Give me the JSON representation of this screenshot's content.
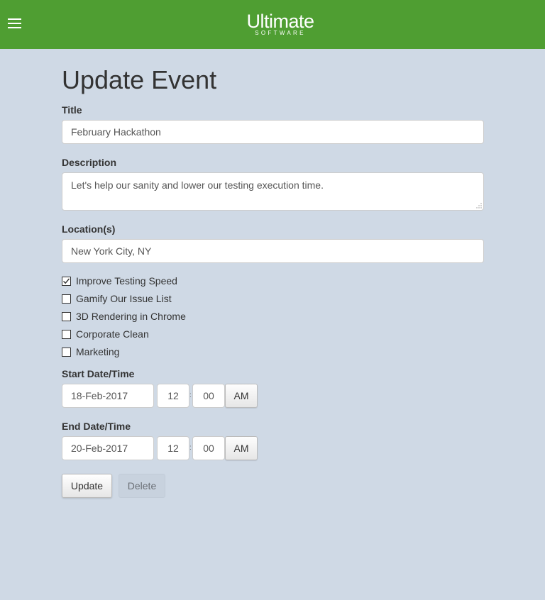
{
  "header": {
    "logo_main": "Ultimate",
    "logo_sub": "SOFTWARE",
    "menu_icon": "hamburger-menu-icon"
  },
  "page": {
    "title": "Update Event"
  },
  "form": {
    "title_label": "Title",
    "title_value": "February Hackathon",
    "description_label": "Description",
    "description_value": "Let's help our sanity and lower our testing execution time.",
    "location_label": "Location(s)",
    "location_value": "New York City, NY",
    "categories": [
      {
        "label": "Improve Testing Speed",
        "checked": true
      },
      {
        "label": "Gamify Our Issue List",
        "checked": false
      },
      {
        "label": "3D Rendering in Chrome",
        "checked": false
      },
      {
        "label": "Corporate Clean",
        "checked": false
      },
      {
        "label": "Marketing",
        "checked": false
      }
    ],
    "start": {
      "label": "Start Date/Time",
      "date": "18-Feb-2017",
      "hour": "12",
      "separator": ":",
      "minute": "00",
      "meridiem": "AM"
    },
    "end": {
      "label": "End Date/Time",
      "date": "20-Feb-2017",
      "hour": "12",
      "separator": ":",
      "minute": "00",
      "meridiem": "AM"
    },
    "update_label": "Update",
    "delete_label": "Delete"
  },
  "colors": {
    "header_bg": "#4f9e32",
    "page_bg": "#cfd9e5"
  }
}
